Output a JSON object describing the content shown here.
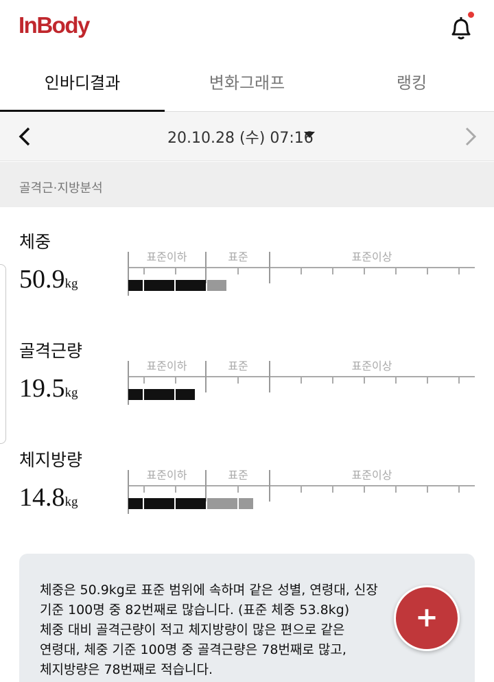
{
  "app": {
    "logo": "InBody",
    "logo_color": "#c0272d",
    "notification_dot_color": "#e53935"
  },
  "tabs": [
    {
      "label": "인바디결과",
      "active": true
    },
    {
      "label": "변화그래프",
      "active": false
    },
    {
      "label": "랭킹",
      "active": false
    }
  ],
  "date_nav": {
    "date": "20.10.28 (수) 07:16"
  },
  "section": {
    "title": "골격근·지방분석"
  },
  "zones": {
    "below": "표준이하",
    "standard": "표준",
    "above": "표준이상"
  },
  "metrics": [
    {
      "label": "체중",
      "value": "50.9",
      "unit": "kg",
      "black_segments": 3,
      "gray_segments": 1
    },
    {
      "label": "골격근량",
      "value": "19.5",
      "unit": "kg",
      "black_segments": 3,
      "gray_segments": 0
    },
    {
      "label": "체지방량",
      "value": "14.8",
      "unit": "kg",
      "black_segments": 3,
      "gray_segments": 2
    }
  ],
  "info": {
    "lines": [
      "체중은 50.9kg로 표준 범위에 속하며 같은 성별, 연령대, 신장",
      "기준 100명 중 82번째로 많습니다. (표준 체중 53.8kg)",
      "체중 대비 골격근량이 적고 체지방량이 많은 편으로 같은",
      "연령대, 체중 기준 100명 중 골격근량은 78번째로 많고,",
      "체지방량은 78번째로 적습니다."
    ]
  },
  "fab": {
    "label": "+",
    "color": "#c0373a"
  }
}
